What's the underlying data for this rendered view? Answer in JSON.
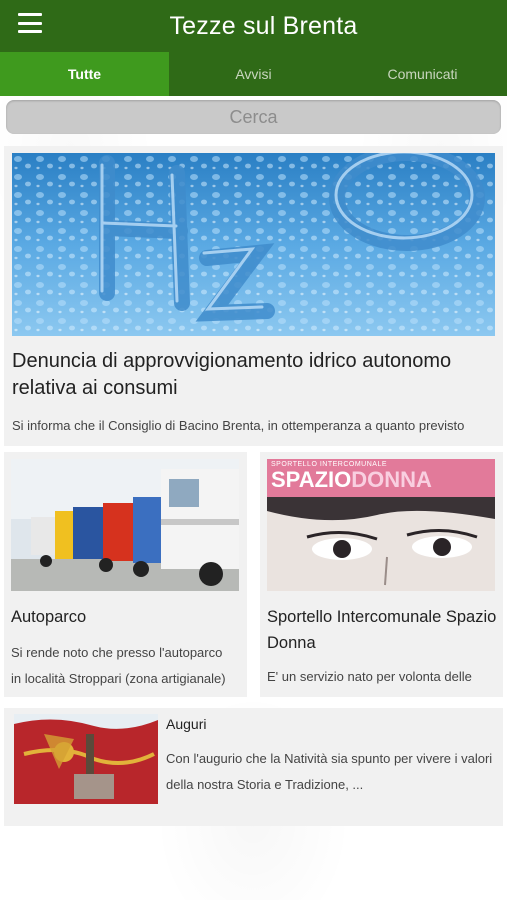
{
  "header": {
    "title": "Tezze sul Brenta",
    "menu_icon": "hamburger-menu-icon",
    "color": "#2f6a17"
  },
  "tabs": [
    {
      "label": "Tutte",
      "active": true
    },
    {
      "label": "Avvisi",
      "active": false
    },
    {
      "label": "Comunicati",
      "active": false
    }
  ],
  "search": {
    "placeholder": "Cerca",
    "value": ""
  },
  "featured": {
    "image": "h2o-water-drops-image",
    "title": "Denuncia di approvvigionamento idrico autonomo relativa ai consumi",
    "excerpt": "Si informa che il Consiglio di Bacino Brenta, in ottemperanza a quanto previsto"
  },
  "cards": [
    {
      "image": "trucks-parking-image",
      "title": "Autoparco",
      "excerpt_line1": "Si rende noto che presso l'autoparco",
      "excerpt_line2": "in località Stroppari (zona artigianale)"
    },
    {
      "image": "spazio-donna-image",
      "image_caption_top": "SPORTELLO INTERCOMUNALE",
      "image_caption_a": "SPAZIO",
      "image_caption_b": "DONNA",
      "title": "Sportello Intercomunale Spazio Donna",
      "excerpt": "E' un servizio nato per volonta delle"
    }
  ],
  "list_item": {
    "image": "venetian-flag-image",
    "title": "Auguri",
    "excerpt": "Con l'augurio che la Natività sia spunto per vivere i valori della nostra Storia e Tradizione, ..."
  }
}
